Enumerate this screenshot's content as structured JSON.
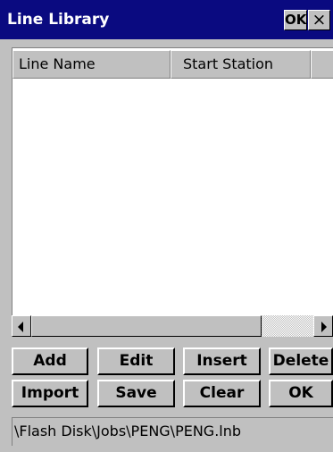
{
  "window": {
    "title": "Line Library",
    "title_ok_label": "OK",
    "close_label": "×"
  },
  "list": {
    "columns": [
      "Line Name",
      "Start Station",
      ""
    ],
    "rows": []
  },
  "buttons": {
    "add": "Add",
    "edit": "Edit",
    "insert": "Insert",
    "delete": "Delete",
    "import": "Import",
    "save": "Save",
    "clear": "Clear",
    "ok": "OK"
  },
  "path": {
    "value": "\\Flash Disk\\Jobs\\PENG\\PENG.lnb"
  },
  "colors": {
    "titlebar": "#0a0a80",
    "face": "#c0c0c0",
    "list_bg": "#ffffff"
  },
  "icons": {
    "scroll_left": "triangle-left-icon",
    "scroll_right": "triangle-right-icon"
  }
}
